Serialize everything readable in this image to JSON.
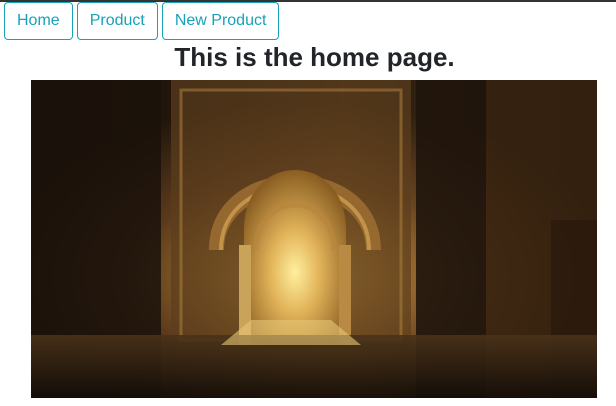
{
  "nav": {
    "items": [
      {
        "label": "Home"
      },
      {
        "label": "Product"
      },
      {
        "label": "New Product"
      }
    ]
  },
  "page": {
    "title": "This is the home page."
  },
  "colors": {
    "accent": "#17a2b8",
    "title": "#212529"
  }
}
